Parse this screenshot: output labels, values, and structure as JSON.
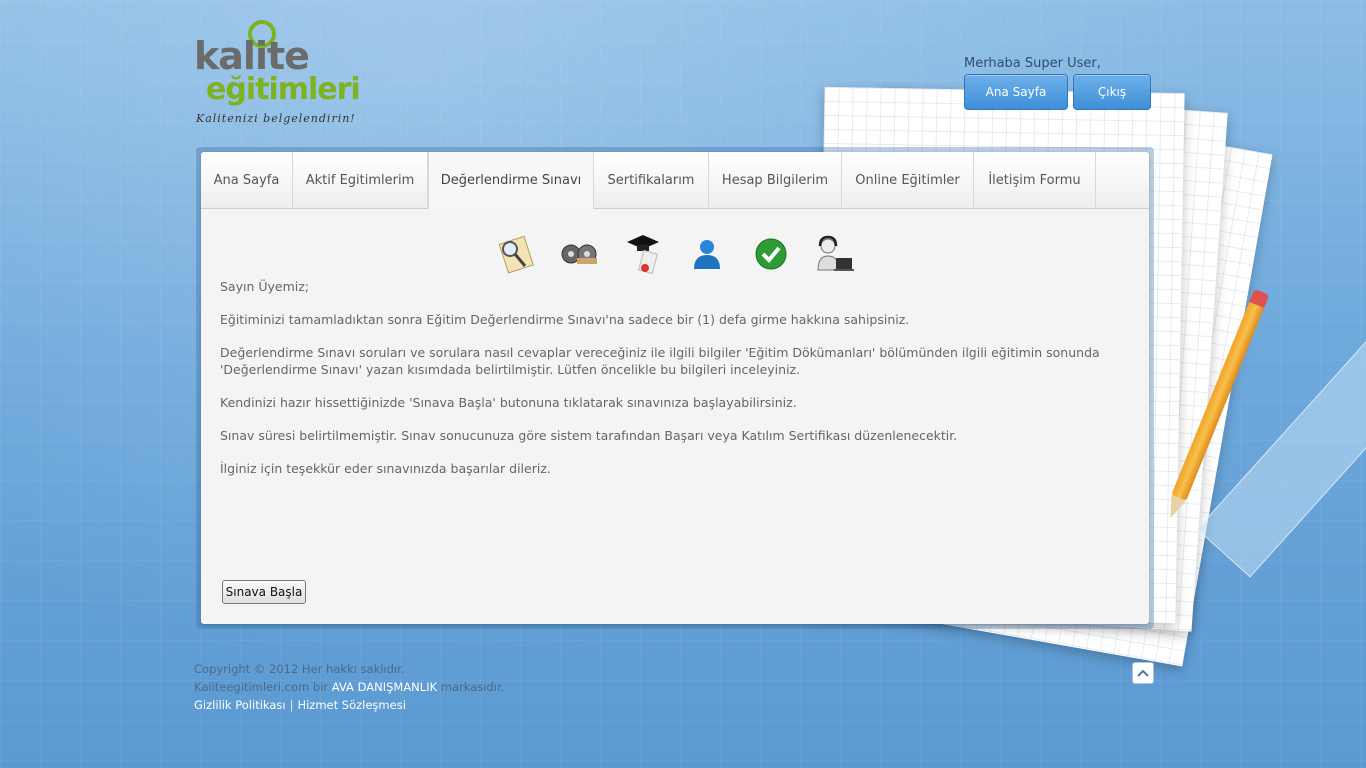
{
  "logo": {
    "line1": "kalite",
    "line2": "eğitimleri",
    "tagline": "Kalitenizi belgelendirin!"
  },
  "header": {
    "welcome": "Merhaba Super User,",
    "home_button": "Ana Sayfa",
    "logout_button": "Çıkış"
  },
  "tabs": [
    {
      "label": "Ana Sayfa",
      "active": false
    },
    {
      "label": "Aktif Egitimlerim",
      "active": false
    },
    {
      "label": "Değerlendirme Sınavı",
      "active": true
    },
    {
      "label": "Sertifikalarım",
      "active": false
    },
    {
      "label": "Hesap Bilgilerim",
      "active": false
    },
    {
      "label": "Online Eğitimler",
      "active": false
    },
    {
      "label": "İletişim Formu",
      "active": false
    }
  ],
  "icons": [
    "search-document-icon",
    "film-reels-icon",
    "graduation-diploma-icon",
    "user-icon",
    "checkmark-icon",
    "support-agent-icon"
  ],
  "content": {
    "greeting": "Sayın Üyemiz;",
    "p1": "Eğitiminizi tamamladıktan sonra Eğitim Değerlendirme Sınavı'na sadece bir (1) defa girme hakkına sahipsiniz.",
    "p2": "Değerlendirme Sınavı soruları ve sorulara nasıl cevaplar vereceğiniz ile ilgili bilgiler 'Eğitim Dökümanları' bölümünden ilgili eğitimin sonunda 'Değerlendirme Sınavı' yazan kısımdada belirtilmiştir. Lütfen öncelikle bu bilgileri inceleyiniz.",
    "p3": "Kendinizi hazır hissettiğinizde 'Sınava Başla' butonuna tıklatarak sınavınıza başlayabilirsiniz.",
    "p4": "Sınav süresi belirtilmemiştir. Sınav sonucunuza göre sistem tarafından Başarı veya Katılım Sertifikası düzenlenecektir.",
    "p5": "İlginiz için teşekkür eder sınavınızda başarılar dileriz.",
    "start_button": "Sınava Başla"
  },
  "footer": {
    "copyright": "Copyright © 2012 Her hakkı saklıdır.",
    "brand_prefix": "Kaliteegitimleri.com bir",
    "brand_link": "AVA DANIŞMANLIK",
    "brand_suffix": "markasıdır.",
    "privacy": "Gizlilik Politikası",
    "separator": "|",
    "terms": "Hizmet Sözleşmesi"
  }
}
